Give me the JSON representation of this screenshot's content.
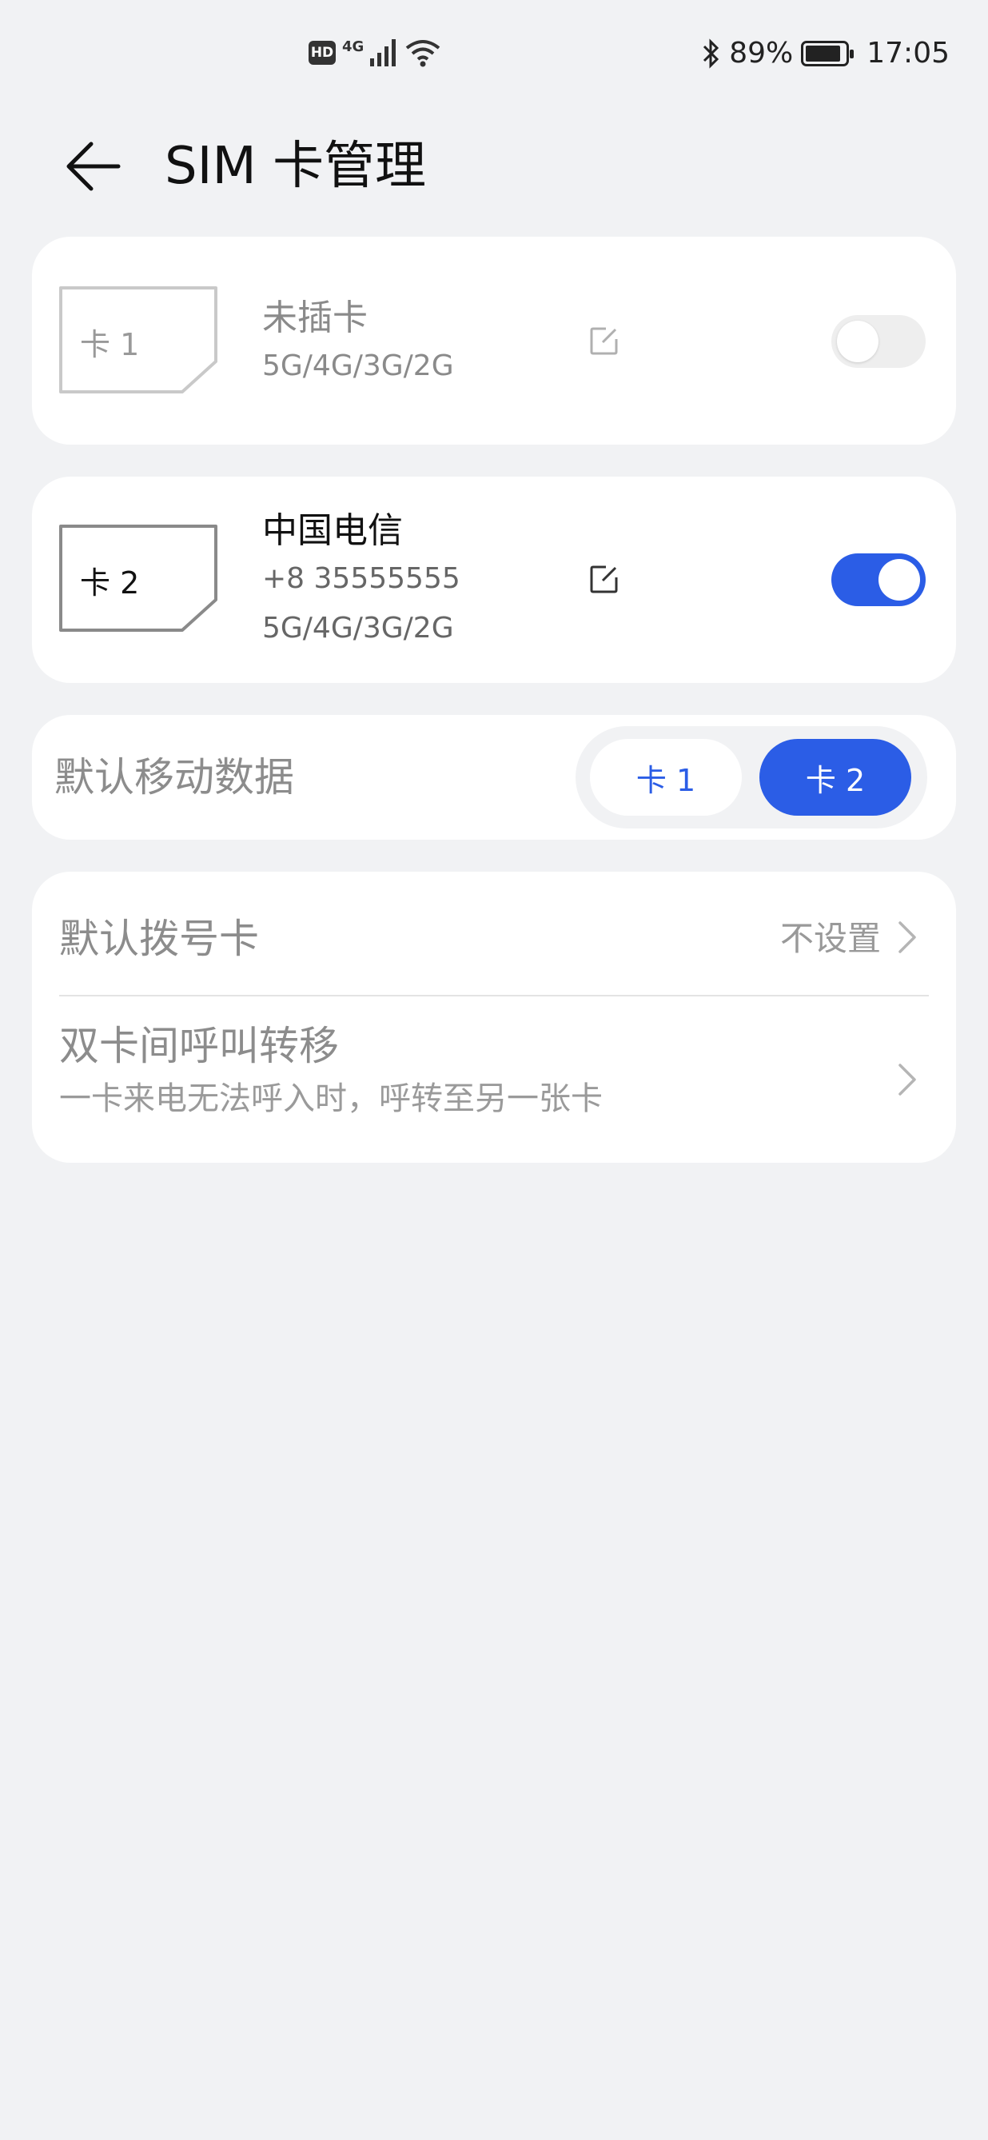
{
  "status_bar": {
    "hd": "HD",
    "network": "4G",
    "battery": "89%",
    "battery_level": 0.89,
    "time": "17:05"
  },
  "header": {
    "title": "SIM 卡管理"
  },
  "sim1": {
    "slot_label": "卡 1",
    "name": "未插卡",
    "network_types": "5G/4G/3G/2G",
    "enabled": false
  },
  "sim2": {
    "slot_label": "卡 2",
    "name": "中国电信",
    "number": "+8  35555555",
    "network_types": "5G/4G/3G/2G",
    "enabled": true
  },
  "default_data": {
    "label": "默认移动数据",
    "options": [
      "卡 1",
      "卡 2"
    ],
    "selected": "卡 2"
  },
  "default_dial": {
    "label": "默认拨号卡",
    "value": "不设置"
  },
  "call_forward": {
    "label": "双卡间呼叫转移",
    "description": "一卡来电无法呼入时，呼转至另一张卡"
  },
  "colors": {
    "accent": "#2b5de6",
    "background": "#f1f2f4",
    "card": "#ffffff"
  }
}
